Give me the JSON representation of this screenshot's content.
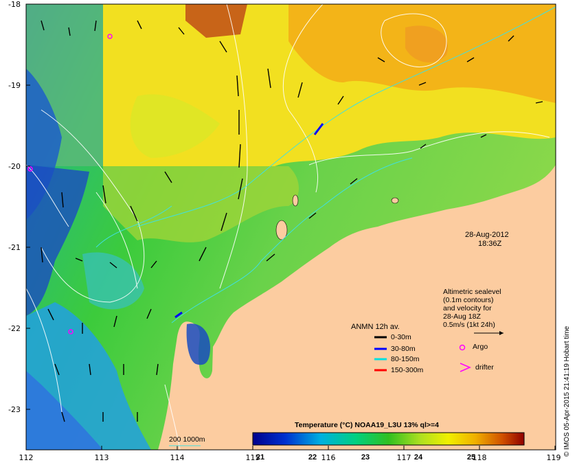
{
  "map": {
    "lat_ticks": [
      "-18",
      "-19",
      "-20",
      "-21",
      "-22",
      "-23"
    ],
    "lon_ticks": [
      "112",
      "113",
      "114",
      "115",
      "116",
      "117",
      "118",
      "119"
    ],
    "datetime": [
      "28-Aug-2012",
      "18:36Z"
    ],
    "altimetric_note": [
      "Altimetric sealevel",
      "(0.1m contours)",
      "and velocity for",
      "28-Aug 18Z",
      "0.5m/s (1kt 24h)"
    ],
    "legend_title": "ANMN 12h av.",
    "depth_legend": [
      {
        "label": "0-30m",
        "color": "#000000"
      },
      {
        "label": "30-80m",
        "color": "#0000ff"
      },
      {
        "label": "80-150m",
        "color": "#00e0e0"
      },
      {
        "label": "150-300m",
        "color": "#ff0000"
      }
    ],
    "argo_label": "Argo",
    "drifter_label": "drifter",
    "isobath_label": "200  1000m",
    "colorbar_title": "Temperature (°C) NOAA19_L3U 13% ql>=4",
    "colorbar_ticks": [
      "21",
      "22",
      "23",
      "24",
      "25"
    ],
    "credit": "© IMOS 05-Apr-2015 21:41:19 Hobart time",
    "colors": {
      "land": "#fccca0",
      "arrow": "#000000",
      "argo": "#ff00ff",
      "isobath": "#40e0e0",
      "contour": "#ffffff"
    }
  }
}
